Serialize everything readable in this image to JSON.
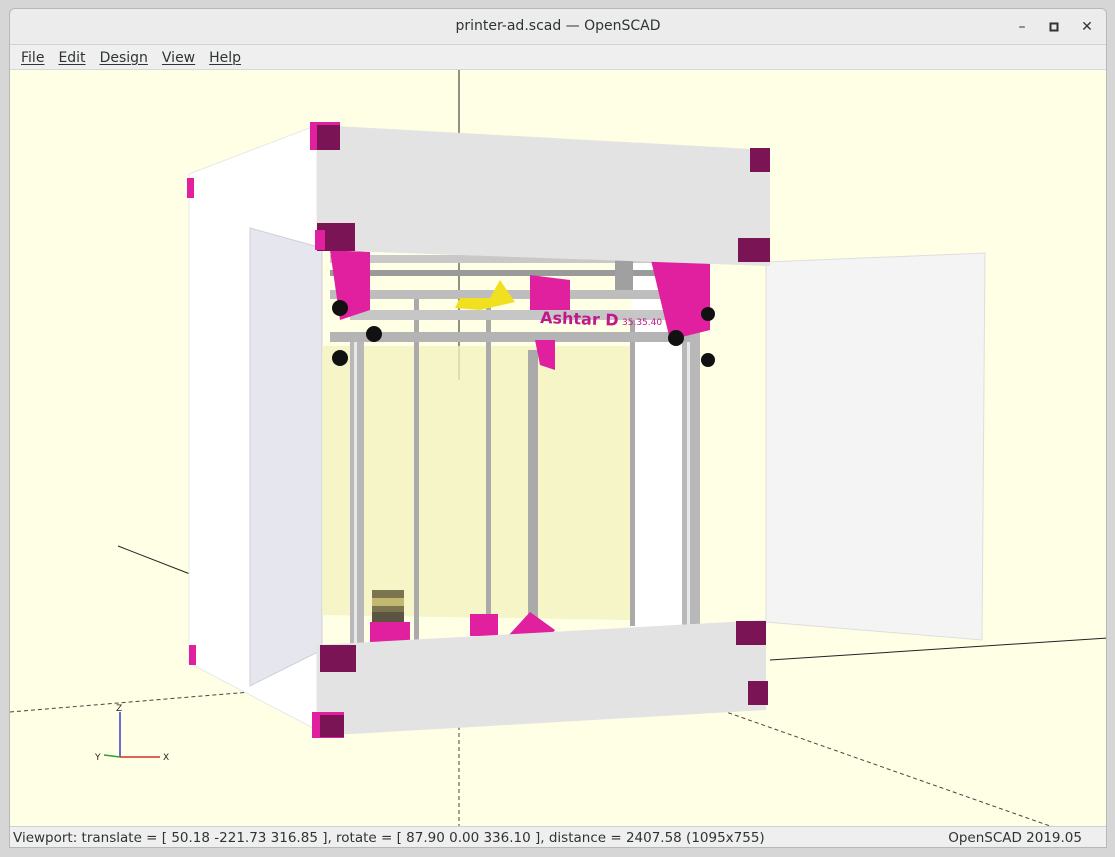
{
  "window": {
    "title": "printer-ad.scad — OpenSCAD",
    "controls": {
      "minimize": "–",
      "maximize": "▫",
      "close": "✕"
    }
  },
  "menubar": {
    "items": [
      {
        "label": "File"
      },
      {
        "label": "Edit"
      },
      {
        "label": "Design"
      },
      {
        "label": "View"
      },
      {
        "label": "Help"
      }
    ]
  },
  "viewport": {
    "model_label": "Ashtar D",
    "model_sublabel": "35.35.40",
    "axes": {
      "z": "Z",
      "y": "Y",
      "x": "X"
    },
    "colors": {
      "background": "#ffffe5",
      "frame_magenta": "#e0209e",
      "corner_dark": "#7a1454",
      "panel_light": "#e3e3e3",
      "panel_white": "#ffffff",
      "inner_glass": "#f2f2c0",
      "rod": "#b8b8b8",
      "nozzle_yellow": "#f0e020"
    }
  },
  "status": {
    "viewport_info": "Viewport: translate = [ 50.18 -221.73 316.85 ], rotate = [ 87.90 0.00 336.10 ], distance = 2407.58 (1095x755)",
    "version": "OpenSCAD 2019.05"
  }
}
